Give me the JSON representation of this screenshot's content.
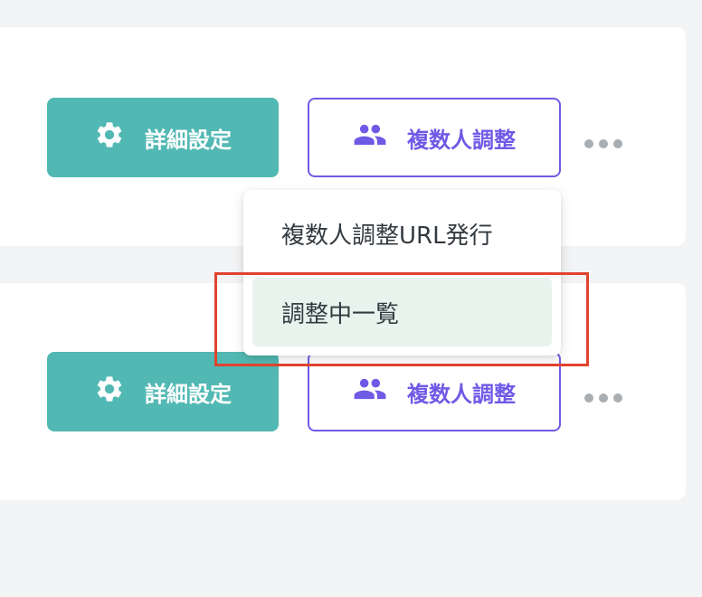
{
  "rows": [
    {
      "settings_label": "詳細設定",
      "multi_label": "複数人調整"
    },
    {
      "settings_label": "詳細設定",
      "multi_label": "複数人調整"
    }
  ],
  "dropdown": {
    "items": [
      {
        "label": "複数人調整URL発行"
      },
      {
        "label": "調整中一覧",
        "state": "hovered"
      }
    ]
  },
  "icons": {
    "settings": "gear-icon",
    "multi": "people-icon",
    "more": "more-horizontal-icon"
  },
  "colors": {
    "page_background": "#f3f4f5",
    "teal_button": "#52b8b3",
    "purple_accent": "#6f5ae6",
    "menu_hover": "#e8f3ee",
    "highlight_frame": "#e0432f"
  }
}
